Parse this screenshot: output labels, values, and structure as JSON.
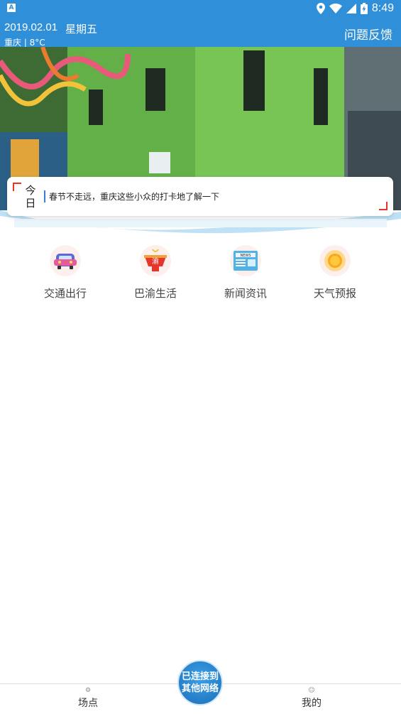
{
  "status_bar": {
    "badge": "A",
    "time": "8:49",
    "icons": [
      "location-icon",
      "wifi-icon",
      "signal-icon",
      "battery-icon"
    ]
  },
  "header": {
    "date": "2019.02.01",
    "weekday": "星期五",
    "weather": "重庆 | 8°C",
    "feedback": "问题反馈"
  },
  "banner": {
    "slide_count": 5,
    "active_index": 0
  },
  "today": {
    "label_line1": "今",
    "label_line2": "日",
    "headline": "春节不走远，重庆这些小众的打卡地了解一下"
  },
  "quick_links": [
    {
      "label": "交通出行",
      "icon": "car-icon"
    },
    {
      "label": "巴渝生活",
      "icon": "hotpot-icon"
    },
    {
      "label": "新闻资讯",
      "icon": "news-icon"
    },
    {
      "label": "天气预报",
      "icon": "sun-icon"
    }
  ],
  "bottom_nav": {
    "left_label": "场点",
    "right_label": "我的",
    "connect_line1": "已连接到",
    "connect_line2": "其他网络"
  },
  "colors": {
    "brand": "#2f8fd8",
    "accent_red": "#e8352b",
    "dot_active": "#3a7bd5"
  }
}
